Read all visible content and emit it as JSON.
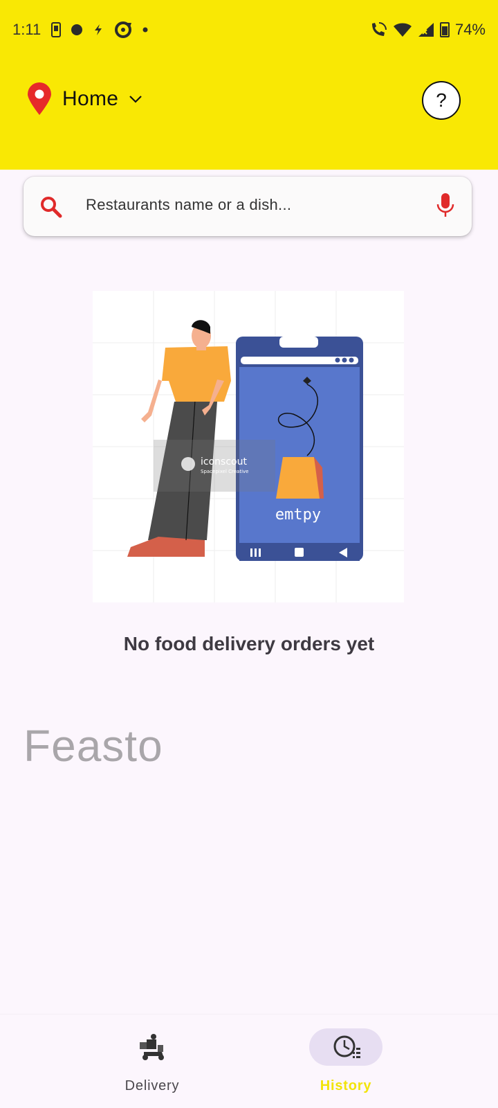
{
  "status_bar": {
    "time": "1:11",
    "battery": "74%",
    "left_icons": [
      "phone-icon",
      "circle-icon",
      "bolt-icon",
      "refresh-icon",
      "dot-icon"
    ],
    "right_icons": [
      "call-wifi-icon",
      "wifi-icon",
      "signal-icon",
      "battery-icon"
    ]
  },
  "header": {
    "location_label": "Home",
    "help_symbol": "?",
    "pin_color": "#e62a2a",
    "bg_color": "#f9e804"
  },
  "search": {
    "placeholder": "Restaurants name or a dish...",
    "accent_color": "#e02a2a"
  },
  "illustration": {
    "watermark_brand": "iconscout",
    "watermark_sub": "Spacepixel Creative",
    "phone_text": "emtpy"
  },
  "empty_state": {
    "title": "No food delivery orders yet"
  },
  "brand": {
    "name": "Feasto"
  },
  "bottom_nav": {
    "items": [
      {
        "label": "Delivery",
        "icon": "delivery-scooter-icon",
        "active": false
      },
      {
        "label": "History",
        "icon": "history-clock-icon",
        "active": true
      }
    ],
    "active_color": "#f2e40a"
  }
}
